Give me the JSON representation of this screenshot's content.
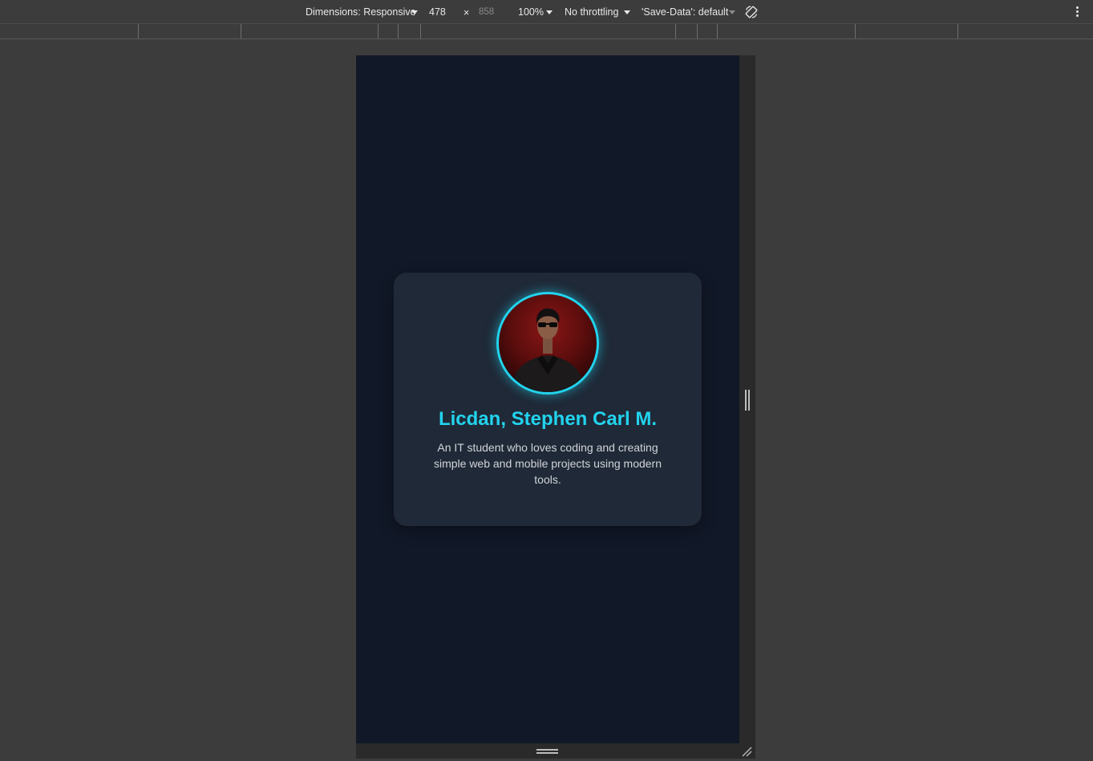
{
  "devtools": {
    "dimensions_label": "Dimensions: Responsive",
    "width_value": "478",
    "times_symbol": "×",
    "height_value": "858",
    "zoom_label": "100%",
    "throttling_label": "No throttling",
    "save_data_label": "'Save-Data': default",
    "icons": {
      "rotate": "rotate-device-icon",
      "more": "more-options-icon"
    }
  },
  "profile": {
    "name": "Licdan, Stephen Carl M.",
    "bio": "An IT student who loves coding and creating simple web and mobile projects using modern tools.",
    "photo": "profile-photo"
  },
  "colors": {
    "page_background": "#111827",
    "card_background": "#1f2937",
    "accent": "#22d3ee",
    "bio_text": "#d1d5db",
    "devtools_background": "#3c3c3c"
  }
}
